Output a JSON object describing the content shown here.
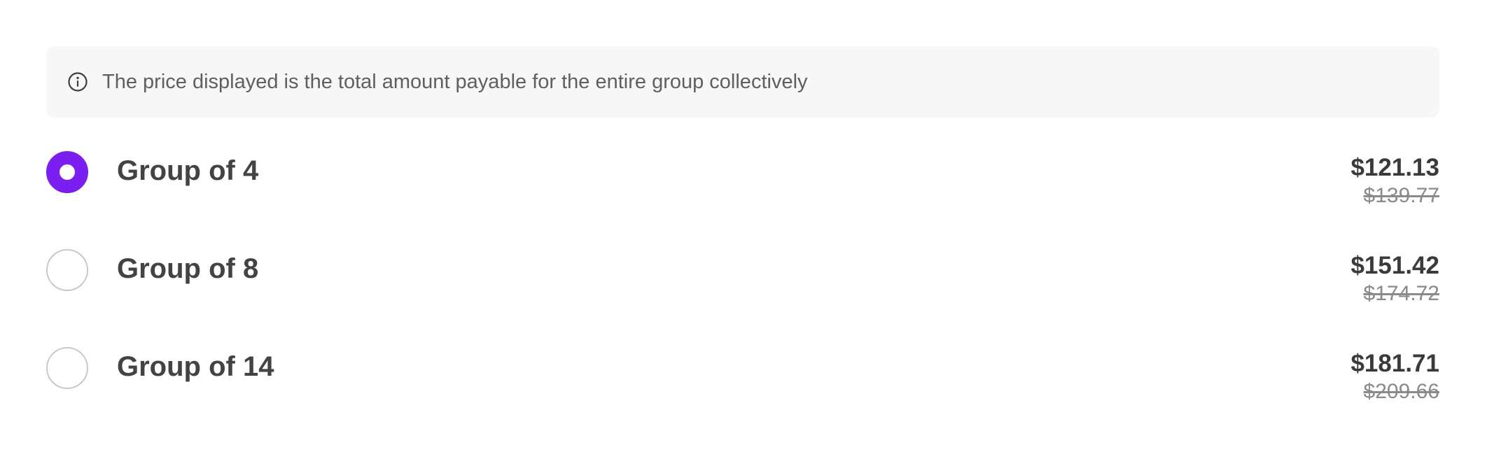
{
  "info": {
    "icon": "info-icon",
    "text": "The price displayed is the total amount payable for the entire group collectively"
  },
  "accent_color": "#7a1ff0",
  "options": [
    {
      "label": "Group of 4",
      "price": "$121.13",
      "original_price": "$139.77",
      "selected": true
    },
    {
      "label": "Group of 8",
      "price": "$151.42",
      "original_price": "$174.72",
      "selected": false
    },
    {
      "label": "Group of 14",
      "price": "$181.71",
      "original_price": "$209.66",
      "selected": false
    }
  ]
}
